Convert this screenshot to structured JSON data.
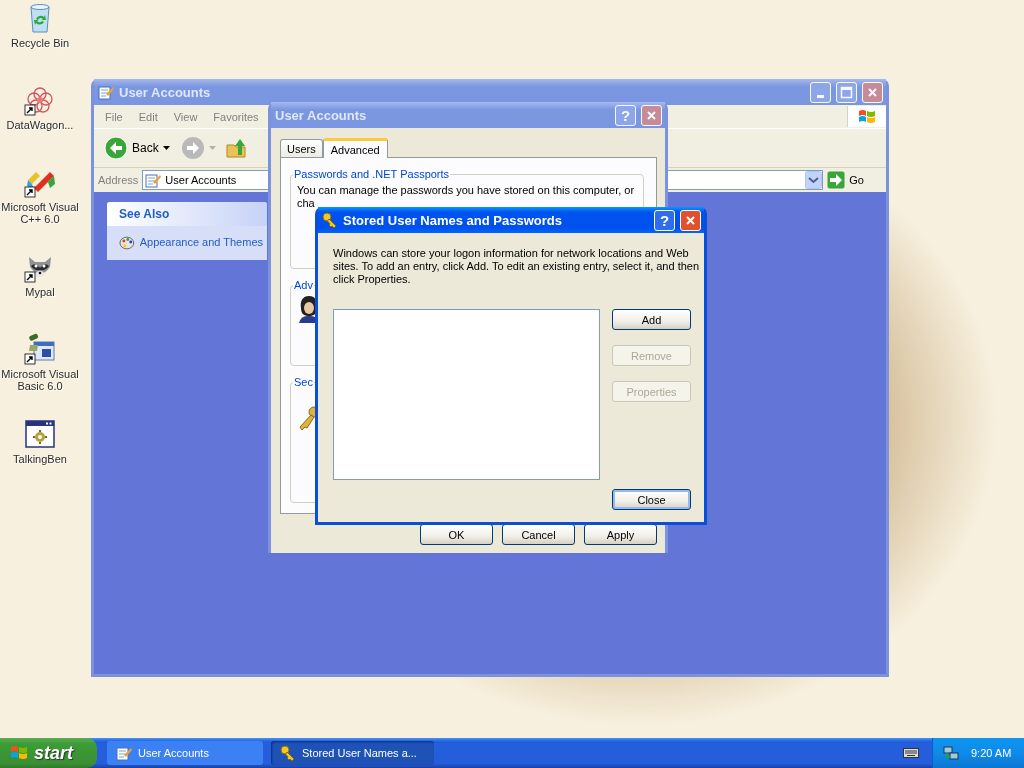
{
  "desktop_icons": [
    {
      "kind": "recycle-bin",
      "label": "Recycle Bin",
      "shortcut": false
    },
    {
      "kind": "flower",
      "label": "DataWagon...",
      "shortcut": true
    },
    {
      "kind": "pen",
      "label": "Microsoft Visual C++ 6.0",
      "shortcut": true
    },
    {
      "kind": "raccoon",
      "label": "Mypal",
      "shortcut": true
    },
    {
      "kind": "blocks",
      "label": "Microsoft Visual Basic 6.0",
      "shortcut": true
    },
    {
      "kind": "app",
      "label": "TalkingBen",
      "shortcut": false
    }
  ],
  "explorer_window": {
    "title": "User Accounts",
    "active": false,
    "menu": [
      "File",
      "Edit",
      "View",
      "Favorites"
    ],
    "back_label": "Back",
    "address": {
      "label": "Address",
      "value": "User Accounts",
      "go": "Go"
    },
    "see_also": {
      "title": "See Also",
      "links": [
        "Appearance and Themes"
      ]
    }
  },
  "user_accounts_dialog": {
    "title": "User Accounts",
    "active": false,
    "help": "?",
    "tabs": [
      {
        "label": "Users",
        "selected": false
      },
      {
        "label": "Advanced",
        "selected": true
      }
    ],
    "groups": [
      {
        "kind": "text",
        "legend": "Passwords and .NET Passports",
        "lines": [
          "You can manage the passwords you have stored on this computer, or",
          "cha"
        ]
      },
      {
        "kind": "person",
        "legend": "Adv"
      },
      {
        "kind": "key",
        "legend": "Sec"
      }
    ],
    "buttons": [
      "OK",
      "Cancel",
      "Apply"
    ]
  },
  "stored_dialog": {
    "title": "Stored User Names and Passwords",
    "active": true,
    "help": "?",
    "description": "Windows can store your logon information for network locations and Web sites. To add an entry, click Add. To edit an existing entry, select it, and then click Properties.",
    "buttons": [
      {
        "label": "Add",
        "disabled": false,
        "default": false
      },
      {
        "label": "Remove",
        "disabled": true,
        "default": false
      },
      {
        "label": "Properties",
        "disabled": true,
        "default": false
      }
    ],
    "close": {
      "label": "Close",
      "disabled": false,
      "default": true
    }
  },
  "taskbar": {
    "start": "start",
    "tasks": [
      {
        "kind": "folder",
        "label": "User Accounts",
        "selected": false
      },
      {
        "kind": "key",
        "label": "Stored User Names a...",
        "selected": true
      }
    ],
    "clock": "9:20 AM"
  }
}
